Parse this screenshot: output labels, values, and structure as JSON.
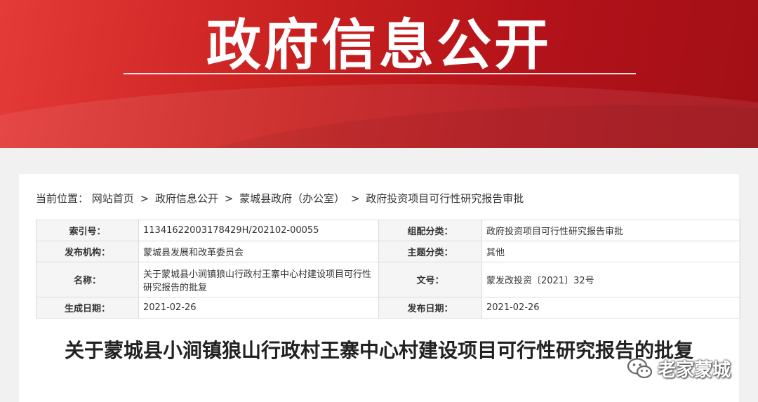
{
  "banner": {
    "title": "政府信息公开"
  },
  "breadcrumb": {
    "prefix": "当前位置：",
    "items": [
      "网站首页",
      "政府信息公开",
      "蒙城县政府（办公室）",
      "政府投资项目可行性研究报告审批"
    ],
    "separator": ">"
  },
  "info": {
    "index_no_label": "索引号：",
    "index_no": "11341622003178429H/202102-00055",
    "category_label": "组配分类：",
    "category": "政府投资项目可行性研究报告审批",
    "publisher_label": "发布机构：",
    "publisher": "蒙城县发展和改革委员会",
    "topic_label": "主题分类：",
    "topic": "其他",
    "name_label": "名称：",
    "name": "关于蒙城县小涧镇狼山行政村王寨中心村建设项目可行性研究报告的批复",
    "doc_no_label": "文号：",
    "doc_no": "蒙发改投资〔2021〕32号",
    "created_label": "生成日期：",
    "created": "2021-02-26",
    "published_label": "发布日期：",
    "published": "2021-02-26"
  },
  "article": {
    "title": "关于蒙城县小涧镇狼山行政村王寨中心村建设项目可行性研究报告的批复"
  },
  "watermark": {
    "icon": "wechat-icon",
    "text": "老家蒙城"
  },
  "colors": {
    "banner_red": "#c8201f",
    "text": "#333333"
  }
}
